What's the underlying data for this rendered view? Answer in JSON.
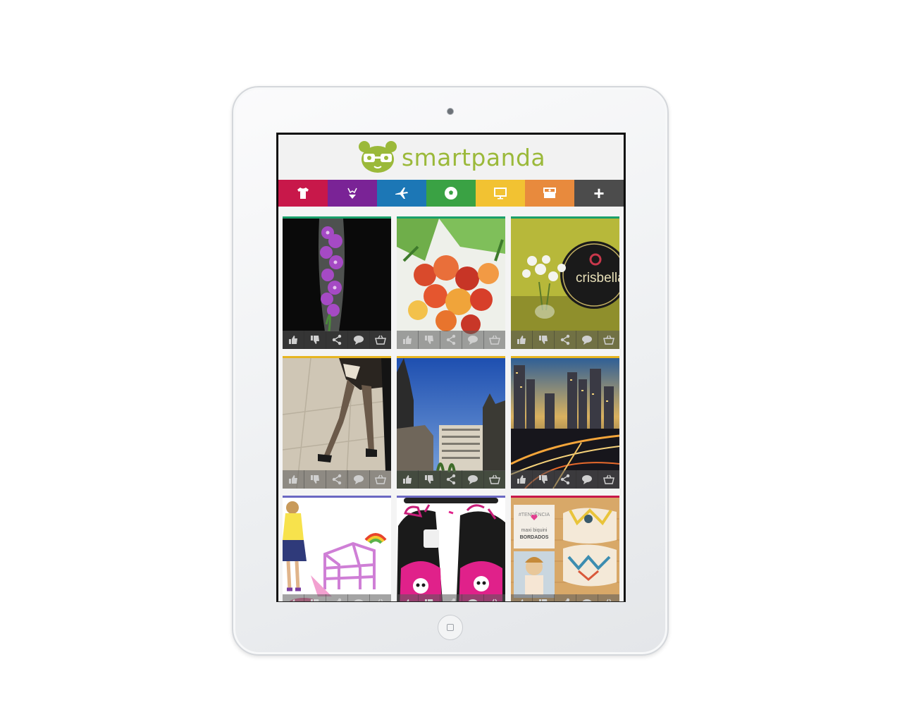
{
  "app": {
    "logo_text": "smartpanda"
  },
  "colors": {
    "brand_green": "#9bb93a",
    "categories": [
      "#c8184a",
      "#7a2396",
      "#1c77b6",
      "#3aa244",
      "#f2c232",
      "#e88a3d",
      "#4c4c4c"
    ]
  },
  "categories": [
    {
      "icon": "tshirt-icon"
    },
    {
      "icon": "bikini-icon"
    },
    {
      "icon": "airplane-icon"
    },
    {
      "icon": "soccer-ball-icon"
    },
    {
      "icon": "monitor-icon"
    },
    {
      "icon": "jewelry-box-icon"
    },
    {
      "icon": "plus-icon",
      "label": "+"
    }
  ],
  "tiles": [
    {
      "image": "purple-orchids-vase",
      "image_text": "",
      "topline": "#1aa06b"
    },
    {
      "image": "flower-bouquet",
      "image_text": "",
      "topline": "#1aa06b"
    },
    {
      "image": "crisbella-flowers-sign",
      "image_text": "crisbella",
      "topline": "#1aa06b"
    },
    {
      "image": "dancer-legs",
      "image_text": "",
      "topline": "#e7b521"
    },
    {
      "image": "city-buildings-blue-sky",
      "image_text": "",
      "topline": "#e7b521"
    },
    {
      "image": "city-night-traffic",
      "image_text": "",
      "topline": "#e7b521"
    },
    {
      "image": "doll-playground-toy",
      "image_text": "",
      "topline": "#6b68c3"
    },
    {
      "image": "monster-high-backpacks",
      "image_text": "",
      "topline": "#6b68c3"
    },
    {
      "image": "maxi-biquini-promo",
      "image_text": "#TENDÊNCIA maxi biquini BORDADOS",
      "topline": "#c8184a"
    }
  ],
  "tile_actions": [
    "like-icon",
    "dislike-icon",
    "share-icon",
    "comment-icon",
    "basket-icon"
  ]
}
